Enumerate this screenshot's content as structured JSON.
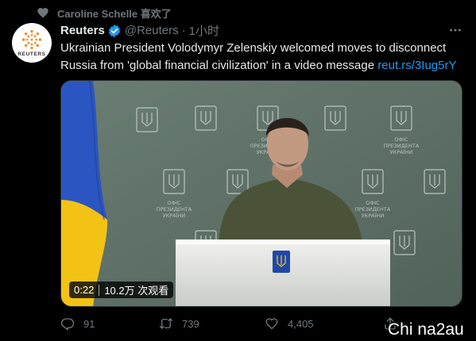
{
  "context": {
    "icon": "heart-icon",
    "text": "Caroline Schelle 喜欢了"
  },
  "tweet": {
    "avatar": {
      "icon": "reuters-logo",
      "text": "REUTERS"
    },
    "author_name": "Reuters",
    "verified": true,
    "handle": "@Reuters",
    "separator": "·",
    "time": "1小时",
    "more_icon": "more-horizontal-icon",
    "text_line1": "Ukrainian President Volodymyr Zelenskiy welcomed moves to disconnect",
    "text_line2": "Russia from 'global financial civilization' in a video message",
    "link": "reut.rs/3Iug5rY",
    "video": {
      "duration": "0:22",
      "views": "10.2万 次观看",
      "wall_caption": [
        "ОФІС",
        "ПРЕЗИДЕНТА",
        "УКРАЇНИ"
      ]
    },
    "actions": [
      {
        "name": "reply",
        "icon": "reply-icon",
        "count": "91"
      },
      {
        "name": "retweet",
        "icon": "retweet-icon",
        "count": "739"
      },
      {
        "name": "like",
        "icon": "heart-outline-icon",
        "count": "4,405"
      },
      {
        "name": "share",
        "icon": "share-icon",
        "count": ""
      }
    ]
  },
  "watermark": "Chi na2au",
  "colors": {
    "background": "#000000",
    "text": "#e7e9ea",
    "muted": "#71767b",
    "link": "#1d9bf0",
    "verified": "#1d9bf0"
  }
}
